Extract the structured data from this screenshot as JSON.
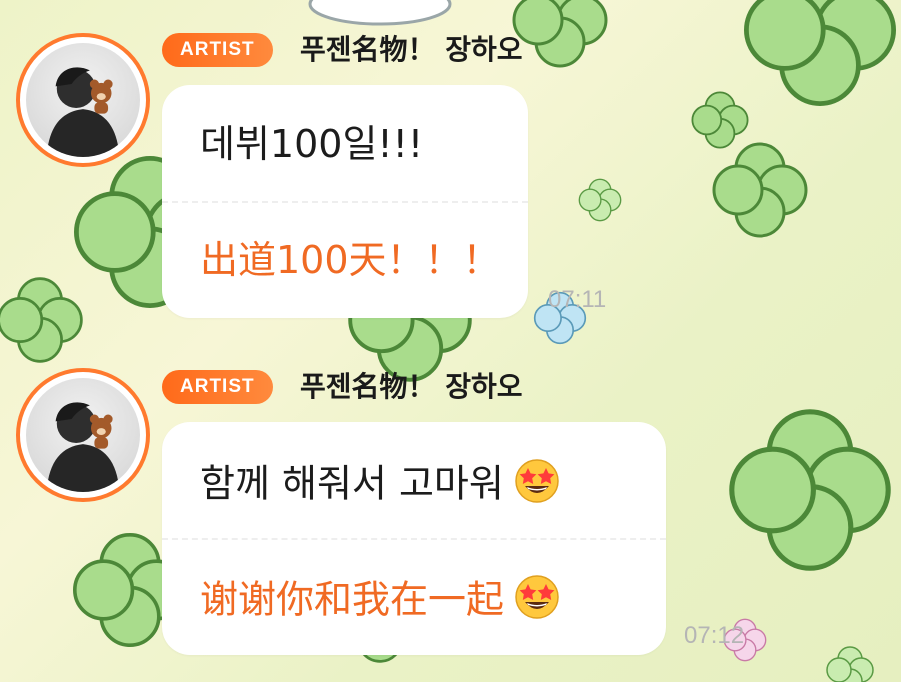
{
  "messages": [
    {
      "badge": "ARTIST",
      "sender": "푸젠名物！ 장하오",
      "text_ko": "데뷔100일!!!",
      "text_zh": "出道100天！！！",
      "time": "07:11",
      "emoji": ""
    },
    {
      "badge": "ARTIST",
      "sender": "푸젠名物！ 장하오",
      "text_ko": "함께 해줘서 고마워",
      "text_zh": "谢谢你和我在一起",
      "time": "07:12",
      "emoji": "star-struck-emoji"
    }
  ],
  "colors": {
    "accent": "#ff7a2e",
    "badge": "#ff6a1a",
    "translation_text": "#f06a23",
    "clover": "#a7dc8a",
    "clover_outline": "#4f8a3a"
  }
}
